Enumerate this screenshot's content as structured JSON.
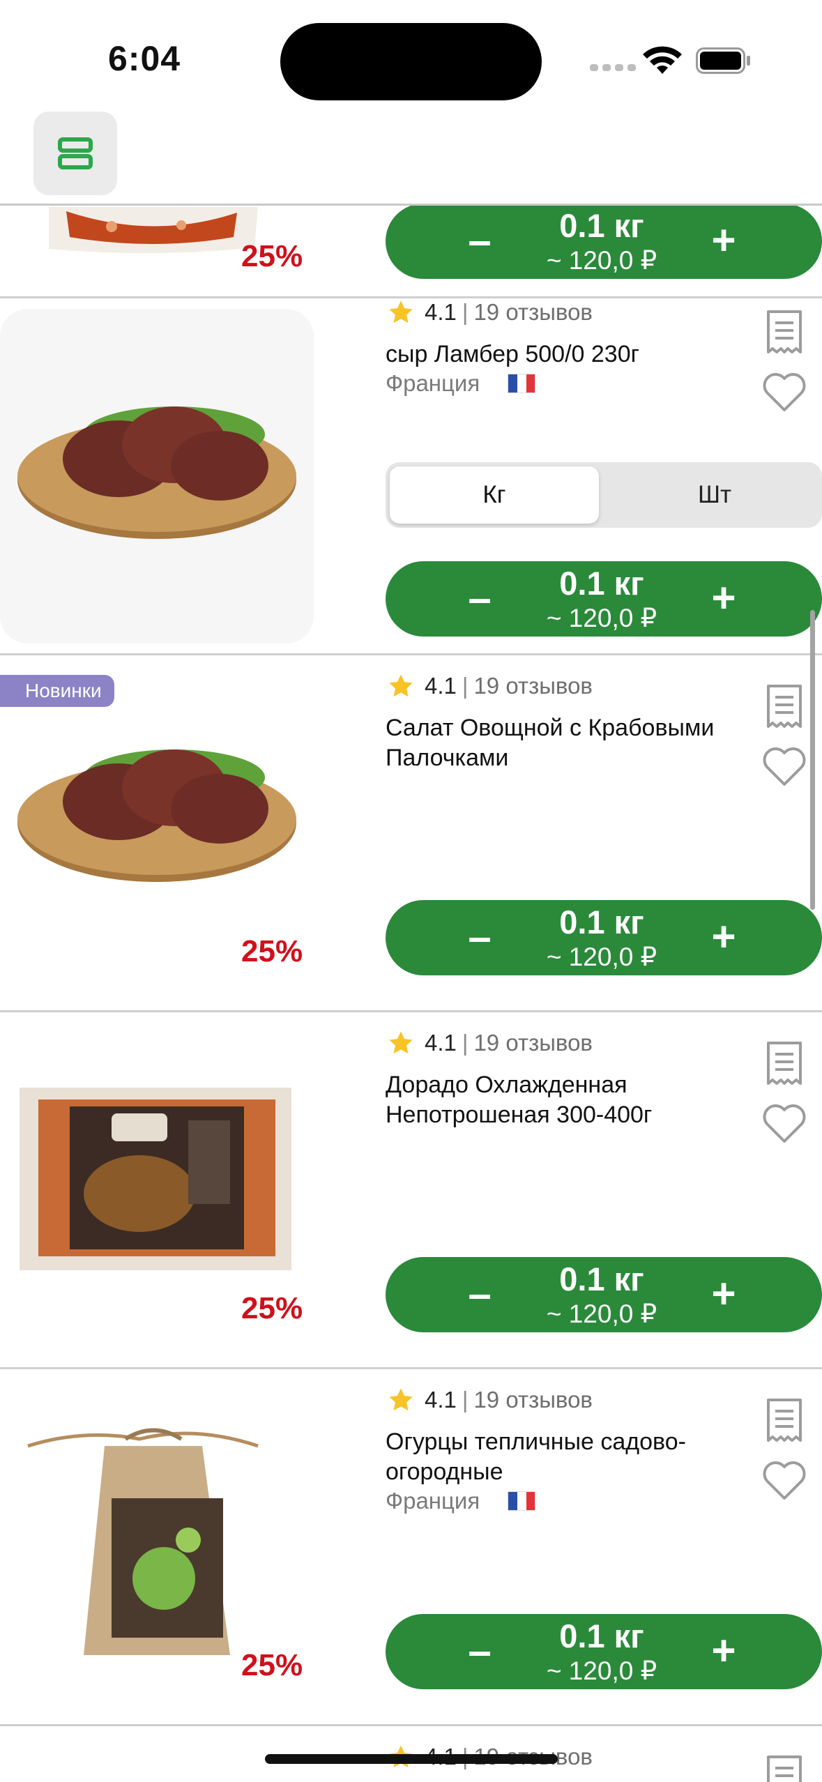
{
  "status": {
    "time": "6:04"
  },
  "colors": {
    "accent": "#2a8a3a",
    "discount": "#d0101b",
    "badge": "#8b83c6",
    "star": "#f7c325"
  },
  "header": {
    "menu_icon": "layout-rows-icon"
  },
  "products": [
    {
      "discount": "25%",
      "quantity": "0.1 кг",
      "price": "~ 120,0 ₽"
    },
    {
      "rating": "4.1",
      "separator": "|",
      "reviews": "19 отзывов",
      "name": "сыр Ламбер 500/0 230г",
      "country": "Франция",
      "unit_options": [
        "Кг",
        "Шт"
      ],
      "unit_selected": "Кг",
      "quantity": "0.1 кг",
      "price": "~ 120,0 ₽"
    },
    {
      "badge": "Новинки",
      "rating": "4.1",
      "separator": "|",
      "reviews": "19 отзывов",
      "name": "Салат Овощной с Крабовыми Палочками",
      "discount": "25%",
      "quantity": "0.1 кг",
      "price": "~ 120,0 ₽"
    },
    {
      "rating": "4.1",
      "separator": "|",
      "reviews": "19 отзывов",
      "name": "Дорадо Охлажденная Непотрошеная 300-400г",
      "discount": "25%",
      "quantity": "0.1 кг",
      "price": "~ 120,0 ₽"
    },
    {
      "rating": "4.1",
      "separator": "|",
      "reviews": "19 отзывов",
      "name": "Огурцы тепличные садово-огородные",
      "country": "Франция",
      "discount": "25%",
      "quantity": "0.1 кг",
      "price": "~ 120,0 ₽"
    },
    {
      "rating": "4.1",
      "separator": "|",
      "reviews": "19 отзывов"
    }
  ]
}
